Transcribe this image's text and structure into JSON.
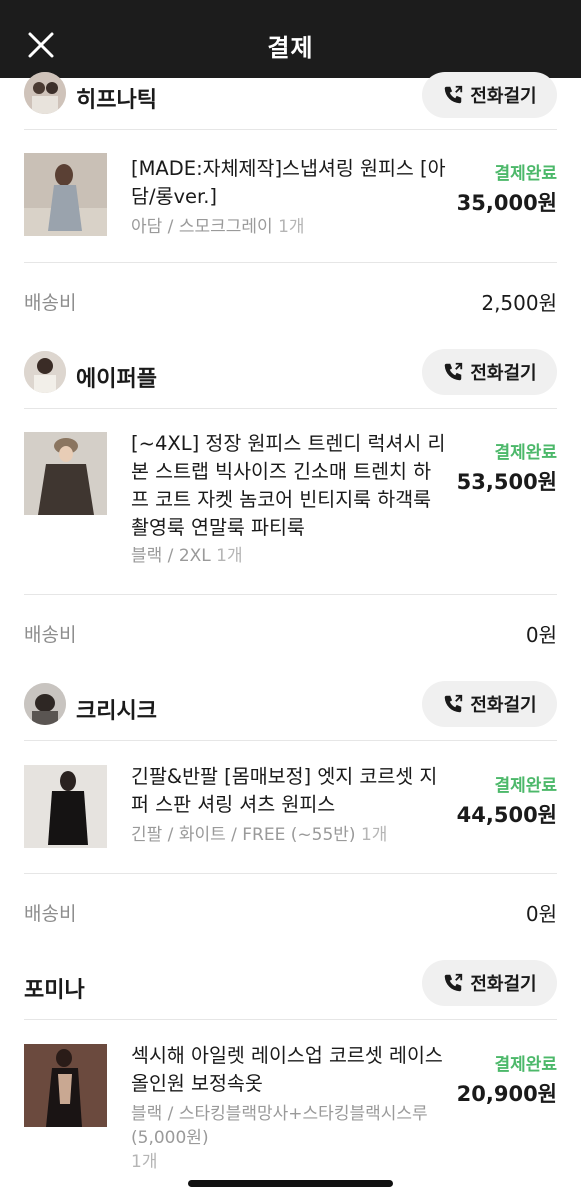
{
  "header": {
    "title": "결제"
  },
  "call_label": "전화걸기",
  "status_color": "#4cb86a",
  "stores": [
    {
      "name": "히프나틱",
      "item": {
        "name": "[MADE:자체제작]스냅셔링 원피스 [아담/롱ver.]",
        "option": "아담 / 스모크그레이",
        "qty": "1개",
        "status": "결제완료",
        "price": "35,000원"
      },
      "shipping_label": "배송비",
      "shipping": "2,500원"
    },
    {
      "name": "에이퍼플",
      "item": {
        "name": "[~4XL] 정장 원피스 트렌디 럭셔시 리본 스트랩 빅사이즈 긴소매 트렌치 하프 코트 자켓 놈코어 빈티지룩 하객룩 촬영룩 연말룩 파티룩",
        "option": "블랙 / 2XL",
        "qty": "1개",
        "status": "결제완료",
        "price": "53,500원"
      },
      "shipping_label": "배송비",
      "shipping": "0원"
    },
    {
      "name": "크리시크",
      "item": {
        "name": "긴팔&반팔 [몸매보정] 엣지 코르셋 지퍼 스판 셔링 셔츠 원피스",
        "option": "긴팔 / 화이트 / FREE (~55반)",
        "qty": "1개",
        "status": "결제완료",
        "price": "44,500원"
      },
      "shipping_label": "배송비",
      "shipping": "0원"
    },
    {
      "name": "포미나",
      "item": {
        "name": "섹시해 아일렛 레이스업 코르셋 레이스 올인원 보정속옷",
        "option": "블랙 / 스타킹블랙망사+스타킹블랙시스루 (5,000원)",
        "qty": "1개",
        "status": "결제완료",
        "price": "20,900원"
      }
    }
  ]
}
